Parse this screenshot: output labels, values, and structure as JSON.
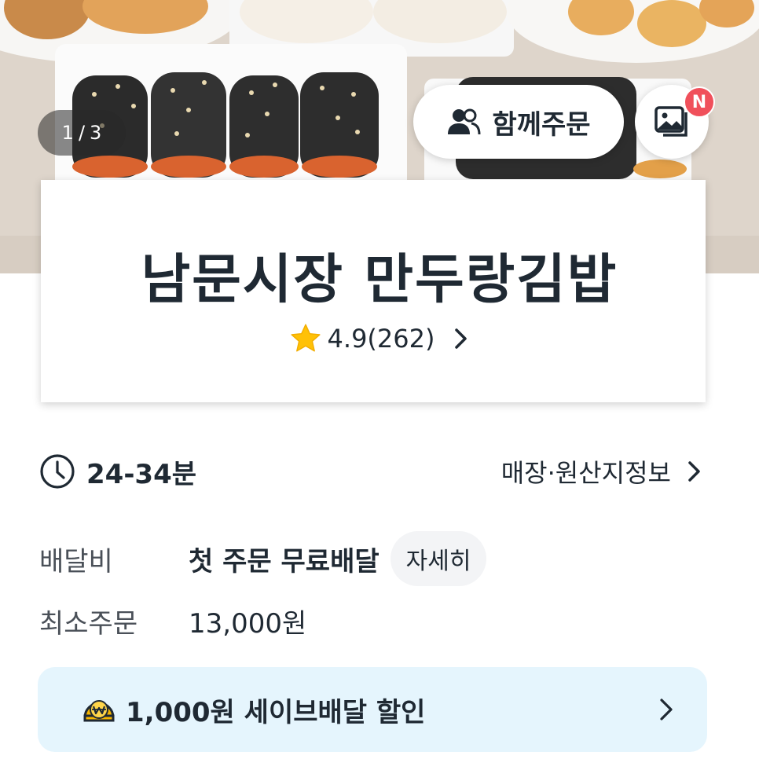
{
  "hero": {
    "page_indicator": {
      "current": "1",
      "separator": "/",
      "total": "3"
    },
    "together_order_label": "함께주문",
    "new_badge": "N"
  },
  "store": {
    "name": "남문시장 만두랑김밥",
    "rating": "4.9",
    "review_count": "(262)"
  },
  "info": {
    "delivery_time": "24-34분",
    "store_info_link": "매장·원산지정보",
    "delivery_fee_label": "배달비",
    "delivery_fee_value": "첫 주문 무료배달",
    "detail_button": "자세히",
    "min_order_label": "최소주문",
    "min_order_value": "13,000원"
  },
  "banner": {
    "save_delivery_text": "1,000원 세이브배달 할인"
  },
  "colors": {
    "star": "#ffc107",
    "badge": "#f0505b",
    "banner_bg": "#e5f5fd",
    "coin": "#f6b500"
  }
}
